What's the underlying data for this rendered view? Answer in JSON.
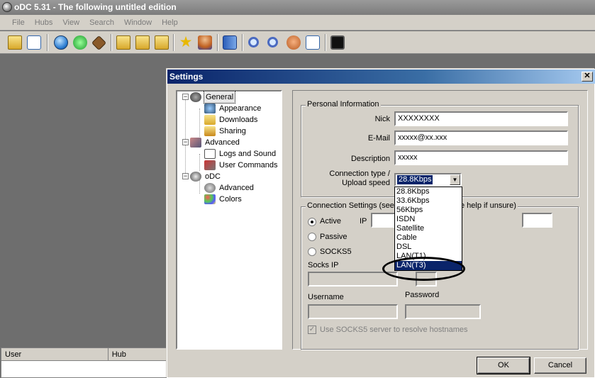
{
  "app": {
    "title": "oDC 5.31 - The following untitled edition",
    "menu": [
      "File",
      "Hubs",
      "View",
      "Search",
      "Window",
      "Help"
    ],
    "toolbar_icons": [
      "open-folder-icon",
      "open-file-icon",
      "public-hubs-icon",
      "reconnect-icon",
      "follow-redirect-icon",
      "favorite-hubs-icon",
      "favorite-users-icon",
      "queue-icon",
      "favorites-star-icon",
      "users-icon",
      "notepad-icon",
      "search-icon",
      "adl-search-icon",
      "spy-icon",
      "search-spy-icon",
      "network-stats-icon"
    ]
  },
  "userhub": {
    "col_user": "User",
    "col_hub": "Hub"
  },
  "settings": {
    "title": "Settings",
    "tree": {
      "general": "General",
      "appearance": "Appearance",
      "downloads": "Downloads",
      "sharing": "Sharing",
      "advanced": "Advanced",
      "logs": "Logs and Sound",
      "user_commands": "User Commands",
      "odc": "oDC",
      "odc_advanced": "Advanced",
      "colors": "Colors"
    },
    "personal": {
      "group_label": "Personal Information",
      "nick_label": "Nick",
      "nick_value": "XXXXXXXX",
      "email_label": "E-Mail",
      "email_value": "xxxxx@xx.xxx",
      "description_label": "Description",
      "description_value": "xxxxx",
      "conn_type_label_1": "Connection type /",
      "conn_type_label_2": "Upload speed",
      "conn_type_value": "28.8Kbps",
      "conn_options": [
        "28.8Kbps",
        "33.6Kbps",
        "56Kbps",
        "ISDN",
        "Satellite",
        "Cable",
        "DSL",
        "LAN(T1)",
        "LAN(T3)"
      ]
    },
    "connection": {
      "group_label_left": "Connection Settings (see",
      "group_label_right": "e help if unsure)",
      "active_label": "Active",
      "ip_label": "IP",
      "passive_label": "Passive",
      "socks5_label": "SOCKS5",
      "socks_ip_label": "Socks IP",
      "username_label": "Username",
      "password_label": "Password",
      "socks_resolve_label": "Use SOCKS5 server to resolve hostnames"
    },
    "ok_label": "OK",
    "cancel_label": "Cancel"
  },
  "colors": {
    "titlebar_active": "#0a246a",
    "dialog_face": "#d4d0c8",
    "selection": "#0a246a"
  }
}
